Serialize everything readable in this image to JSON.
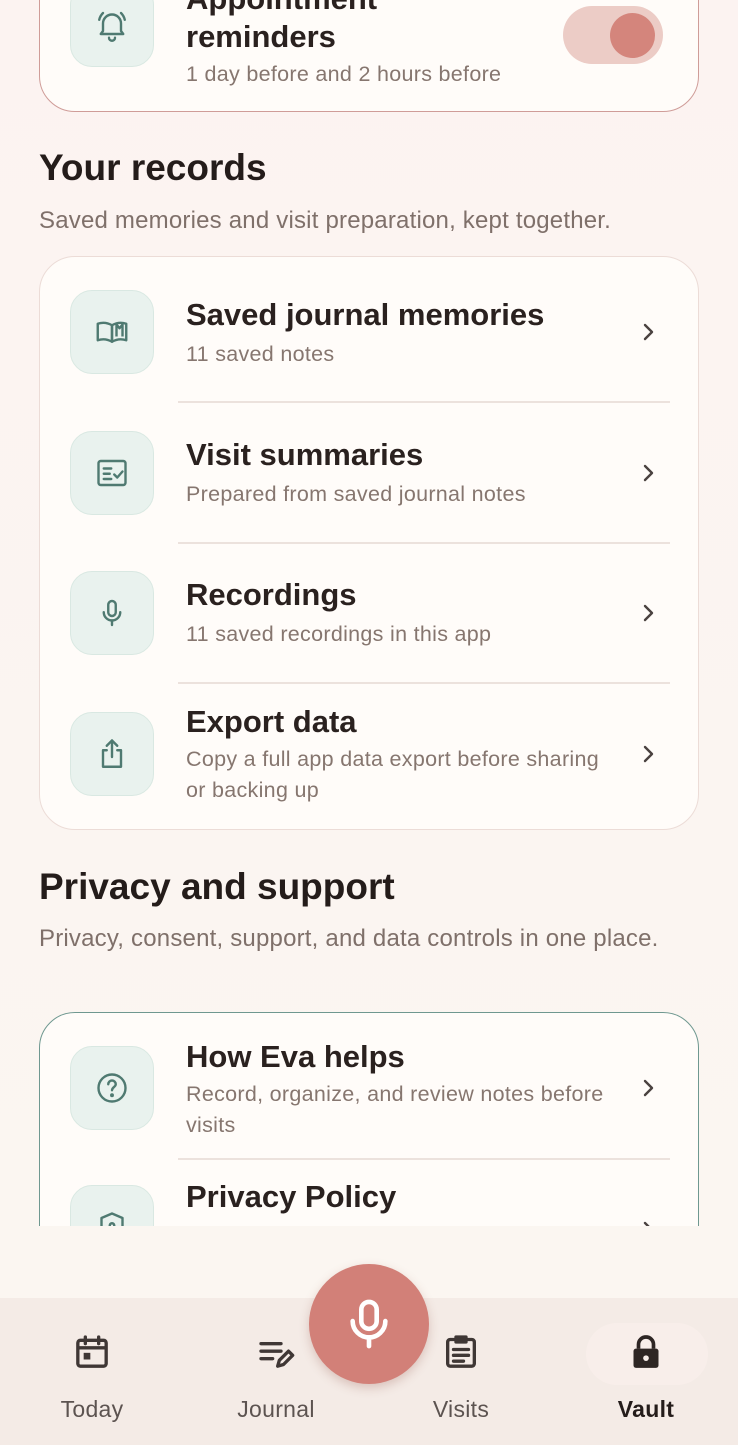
{
  "reminder": {
    "title_partial": "Appointment",
    "title": "reminders",
    "subtitle": "1 day before and 2 hours before",
    "toggle_on": true
  },
  "records": {
    "title": "Your records",
    "subtitle": "Saved memories and visit preparation, kept together.",
    "items": [
      {
        "title": "Saved journal memories",
        "subtitle": "11 saved notes",
        "icon": "book-icon"
      },
      {
        "title": "Visit summaries",
        "subtitle": "Prepared from saved journal notes",
        "icon": "checklist-icon"
      },
      {
        "title": "Recordings",
        "subtitle": "11 saved recordings in this app",
        "icon": "mic-icon"
      },
      {
        "title": "Export data",
        "subtitle": "Copy a full app data export before sharing or backing up",
        "icon": "share-icon"
      }
    ]
  },
  "privacy": {
    "title": "Privacy and support",
    "subtitle": "Privacy, consent, support, and data controls in one place.",
    "items": [
      {
        "title": "How Eva helps",
        "subtitle": "Record, organize, and review notes before visits",
        "icon": "help-icon"
      },
      {
        "title": "Privacy Policy",
        "subtitle": "",
        "icon": "shield-icon"
      }
    ]
  },
  "nav": {
    "items": [
      {
        "label": "Today",
        "icon": "calendar-icon"
      },
      {
        "label": "Journal",
        "icon": "edit-list-icon"
      },
      {
        "label": "Visits",
        "icon": "clipboard-icon"
      },
      {
        "label": "Vault",
        "icon": "lock-icon",
        "active": true
      }
    ],
    "fab_icon": "mic-icon"
  },
  "colors": {
    "accent": "#d28078",
    "teal_tile": "#e9f2ee",
    "icon_teal": "#4f7a71"
  }
}
